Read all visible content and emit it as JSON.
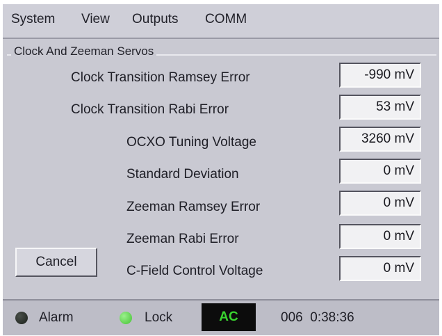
{
  "menu": {
    "items": [
      "System",
      "View",
      "Outputs",
      "COMM"
    ]
  },
  "panel": {
    "title": "Clock And Zeeman Servos",
    "rows": [
      {
        "label": "Clock Transition Ramsey Error",
        "value": "-990 mV"
      },
      {
        "label": "Clock Transition Rabi Error",
        "value": "53 mV"
      },
      {
        "label": "OCXO Tuning Voltage",
        "value": "3260 mV"
      },
      {
        "label": "Standard Deviation",
        "value": "0 mV"
      },
      {
        "label": "Zeeman Ramsey Error",
        "value": "0 mV"
      },
      {
        "label": "Zeeman Rabi Error",
        "value": "0 mV"
      },
      {
        "label": "C-Field Control Voltage",
        "value": "0 mV"
      }
    ],
    "cancel_label": "Cancel"
  },
  "status": {
    "alarm_label": "Alarm",
    "alarm_color": "#1a1f1a",
    "lock_label": "Lock",
    "lock_color": "#45c234",
    "power_label": "AC",
    "power_color": "#39d32f",
    "time": "006  0:38:36"
  }
}
